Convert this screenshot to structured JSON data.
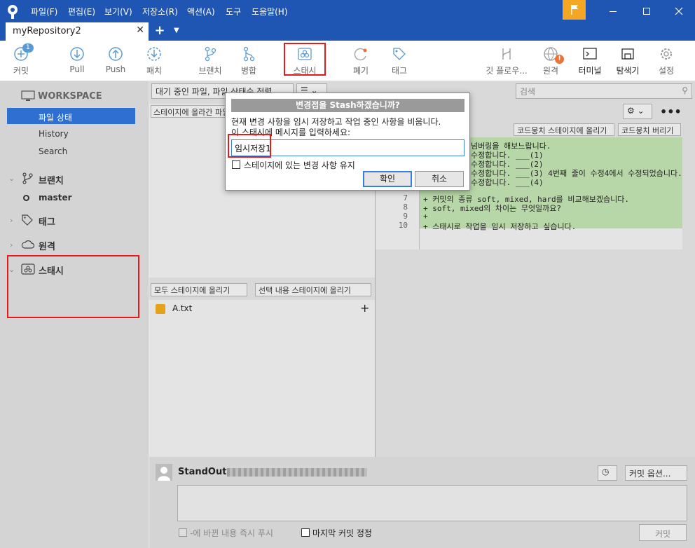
{
  "menu": [
    "파일(F)",
    "편집(E)",
    "보기(V)",
    "저장소(R)",
    "액션(A)",
    "도구",
    "도움말(H)"
  ],
  "tab": {
    "title": "myRepository2",
    "close": "✕",
    "add": "+"
  },
  "toolbar": {
    "commit": "커밋",
    "commit_badge": "1",
    "pull": "Pull",
    "push": "Push",
    "patch": "패치",
    "branch": "브랜치",
    "merge": "병합",
    "stash": "스태시",
    "discard": "폐기",
    "tag": "태그",
    "gitflow": "깃 플로우...",
    "remote": "원격",
    "terminal": "터미널",
    "explorer": "탐색기",
    "settings": "설정"
  },
  "sidebar": {
    "workspace": "WORKSPACE",
    "file_status": "파일 상태",
    "history": "History",
    "search": "Search",
    "branches": "브랜치",
    "master": "master",
    "tags": "태그",
    "remotes": "원격",
    "stashes": "스태시"
  },
  "main": {
    "filter_select": "대기 중인 파일, 파일 상태순 정렬",
    "list_select": "☰",
    "search_placeholder": "검색",
    "staged_header": "스테이지에 올라간 파일",
    "hunk_stage": "코드뭉치 스테이지에 올리기",
    "hunk_discard": "코드뭉치 버리기",
    "stage_all": "모두 스테이지에 올리기",
    "stage_selected": "선택 내용 스테이지에 올리기",
    "unstaged_file": "A.txt",
    "unstaged_add": "+",
    "diff_lines_top": [
      "넘버링을 해보느랍니다.",
      "수정합니다. ___(1)",
      "수정합니다. ___(2)",
      "수정합니다. ___(3) 4번째 줄이 수정4에서 수정되었습니다.",
      "수정합니다. ___(4)"
    ],
    "diff_lines": [
      {
        "num": "7",
        "text": "+ 커밋의 종류 soft, mixed, hard를 비교해보겠습니다."
      },
      {
        "num": "8",
        "text": "+ soft, mixed의 차이는 무엇일까요?"
      },
      {
        "num": "9",
        "text": "+"
      },
      {
        "num": "10",
        "text": "+ 스태시로 작업을 임시 저장하고 싶습니다."
      }
    ]
  },
  "commit": {
    "author": "StandOut",
    "options": "커밋 옵션...",
    "push_now": "-에 바뀐 내용 즉시 푸시",
    "amend": "마지막 커밋 정정",
    "commit_button": "커밋"
  },
  "dialog": {
    "title": "변경점을 Stash하겠습니까?",
    "line1": "현재 변경 사항을 임시 저장하고 작업 중인 사항을 비웁니다.",
    "line2": "이 스태시에 메시지를 입력하세요:",
    "input_value": "임시저장1",
    "keep_staged": "스테이지에 있는 변경 사항 유지",
    "ok": "확인",
    "cancel": "취소"
  },
  "colors": {
    "titlebar": "#1f56b3",
    "accent": "#2f6fd1",
    "annotation": "#e31b1b",
    "flag": "#f5a623"
  }
}
